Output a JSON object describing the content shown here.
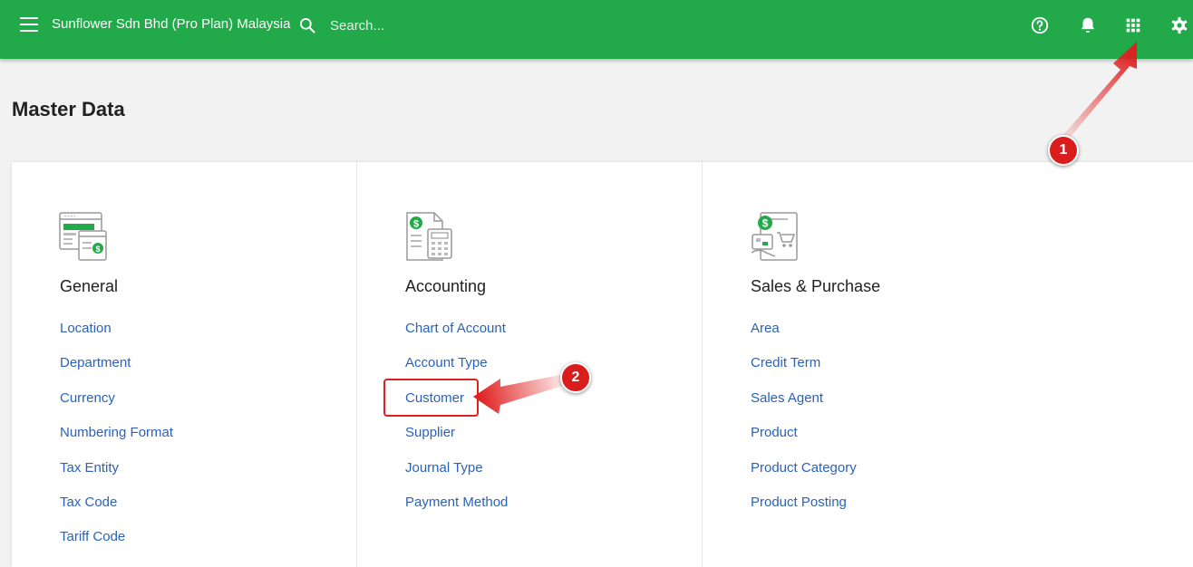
{
  "header": {
    "company": "Sunflower Sdn Bhd (Pro Plan) Malaysia",
    "search_placeholder": "Search...",
    "icons": [
      "menu-icon",
      "search-icon",
      "help-icon",
      "bell-icon",
      "apps-grid-icon",
      "gear-icon"
    ],
    "color": "#22aa4a"
  },
  "page": {
    "title": "Master Data"
  },
  "sections": [
    {
      "title": "General",
      "icon": "general-icon",
      "items": [
        "Location",
        "Department",
        "Currency",
        "Numbering Format",
        "Tax Entity",
        "Tax Code",
        "Tariff Code"
      ]
    },
    {
      "title": "Accounting",
      "icon": "accounting-icon",
      "items": [
        "Chart of Account",
        "Account Type",
        "Customer",
        "Supplier",
        "Journal Type",
        "Payment Method"
      ]
    },
    {
      "title": "Sales & Purchase",
      "icon": "sales-purchase-icon",
      "items": [
        "Area",
        "Credit Term",
        "Sales Agent",
        "Product",
        "Product Category",
        "Product Posting"
      ]
    }
  ],
  "annotations": {
    "step1": "1",
    "step2": "2",
    "color": "#d91c1c"
  },
  "colors": {
    "link": "#2b62b8",
    "icon_green": "#22aa4a"
  }
}
